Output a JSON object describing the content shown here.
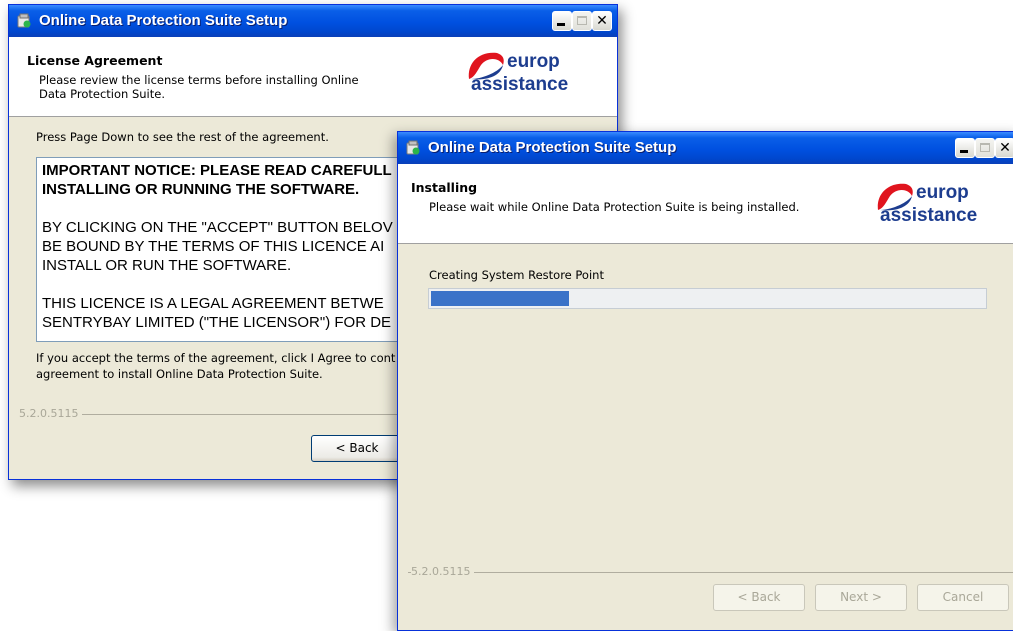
{
  "back_window": {
    "title": "Online Data Protection Suite Setup",
    "header_title": "License Agreement",
    "header_desc": "Please review the license terms before installing Online Data Protection Suite.",
    "logo": {
      "line1": "europ",
      "line2": "assistance"
    },
    "instruction": "Press Page Down to see the rest of the agreement.",
    "license_lines": [
      "IMPORTANT NOTICE: PLEASE READ CAREFULL",
      "INSTALLING OR RUNNING THE SOFTWARE.",
      "BY CLICKING ON THE \"ACCEPT\" BUTTON BELOV",
      "BE BOUND BY THE TERMS OF THIS LICENCE AI",
      "INSTALL OR RUN THE SOFTWARE.",
      "THIS LICENCE IS A LEGAL AGREEMENT BETWE",
      "SENTRYBAY LIMITED (\"THE LICENSOR\") FOR DE"
    ],
    "accept_text_1": "If you accept the terms of the agreement, click I Agree to cont",
    "accept_text_2": "agreement to install Online Data Protection Suite.",
    "version": "5.2.0.5115",
    "back_label": "< Back"
  },
  "front_window": {
    "title": "Online Data Protection Suite Setup",
    "header_title": "Installing",
    "header_desc": "Please wait while Online Data Protection Suite is being installed.",
    "logo": {
      "line1": "europ",
      "line2": "assistance"
    },
    "status": "Creating System Restore Point",
    "progress_fraction": 0.25,
    "version": "5.2.0.5115",
    "back_label": "< Back",
    "next_label": "Next >",
    "cancel_label": "Cancel"
  },
  "colors": {
    "title_bar": "#0050e0",
    "logo_red": "#e0141e",
    "logo_blue": "#1d3d8f",
    "progress": "#3a72c8"
  }
}
